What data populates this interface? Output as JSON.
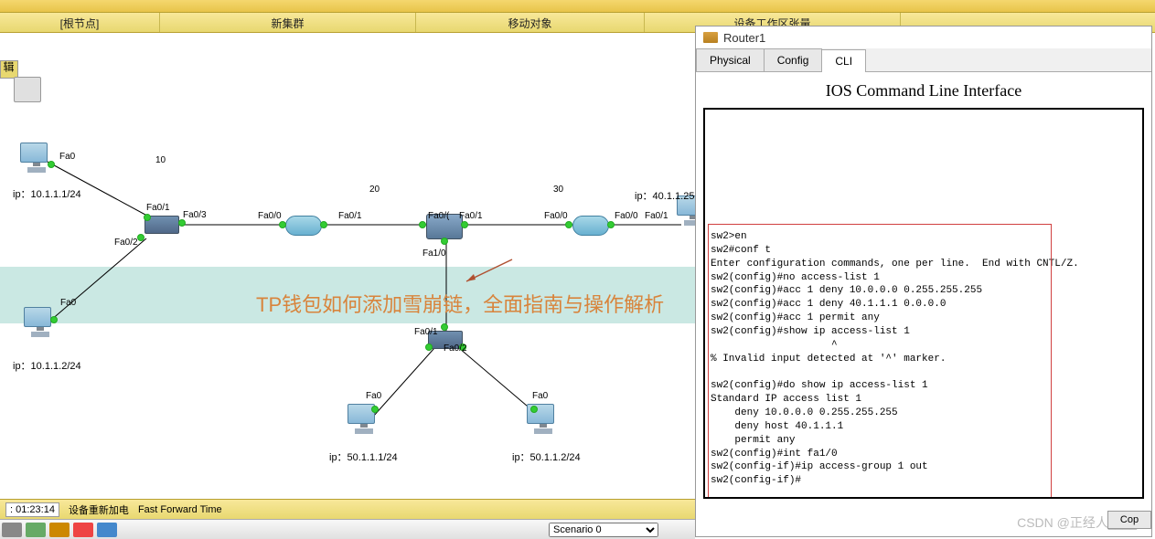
{
  "toolbar": {
    "editLabel": "辑"
  },
  "tabs": {
    "root": "[根节点]",
    "newCluster": "新集群",
    "moveObj": "移动对象",
    "deviceArea": "设备工作区张量"
  },
  "network": {
    "labels": {
      "fa0": "Fa0",
      "fa01": "Fa0/1",
      "fa02": "Fa0/2",
      "fa03": "Fa0/3",
      "fa00": "Fa0/0",
      "fa0c": "Fa0/(",
      "fa10": "Fa1/0"
    },
    "areas": {
      "a10": "10",
      "a20": "20",
      "a30": "30"
    },
    "ips": {
      "pc1": "ip：10.1.1.1/24",
      "pc2": "ip：10.1.1.2/24",
      "pc3": "ip：50.1.1.1/24",
      "pc4": "ip：50.1.1.2/24",
      "pc5": "ip：40.1.1.25"
    }
  },
  "watermark": "TP钱包如何添加雪崩链，全面指南与操作解析",
  "csdn": "CSDN @正经人____",
  "routerWindow": {
    "title": "Router1",
    "tabs": {
      "physical": "Physical",
      "config": "Config",
      "cli": "CLI"
    },
    "cliTitle": "IOS Command Line Interface"
  },
  "cli_lines": [
    "sw2>en",
    "sw2#conf t",
    "Enter configuration commands, one per line.  End with CNTL/Z.",
    "sw2(config)#no access-list 1",
    "sw2(config)#acc 1 deny 10.0.0.0 0.255.255.255",
    "sw2(config)#acc 1 deny 40.1.1.1 0.0.0.0",
    "sw2(config)#acc 1 permit any",
    "sw2(config)#show ip access-list 1",
    "                    ^",
    "% Invalid input detected at '^' marker.",
    "",
    "sw2(config)#do show ip access-list 1",
    "Standard IP access list 1",
    "    deny 10.0.0.0 0.255.255.255",
    "    deny host 40.1.1.1",
    "    permit any",
    "sw2(config)#int fa1/0",
    "sw2(config-if)#ip access-group 1 out",
    "sw2(config-if)#"
  ],
  "copyBtn": "Cop",
  "bottom": {
    "time": ": 01:23:14",
    "power": "设备重新加电",
    "fastfwd": "Fast Forward Time"
  },
  "scenario": {
    "selected": "Scenario 0"
  }
}
